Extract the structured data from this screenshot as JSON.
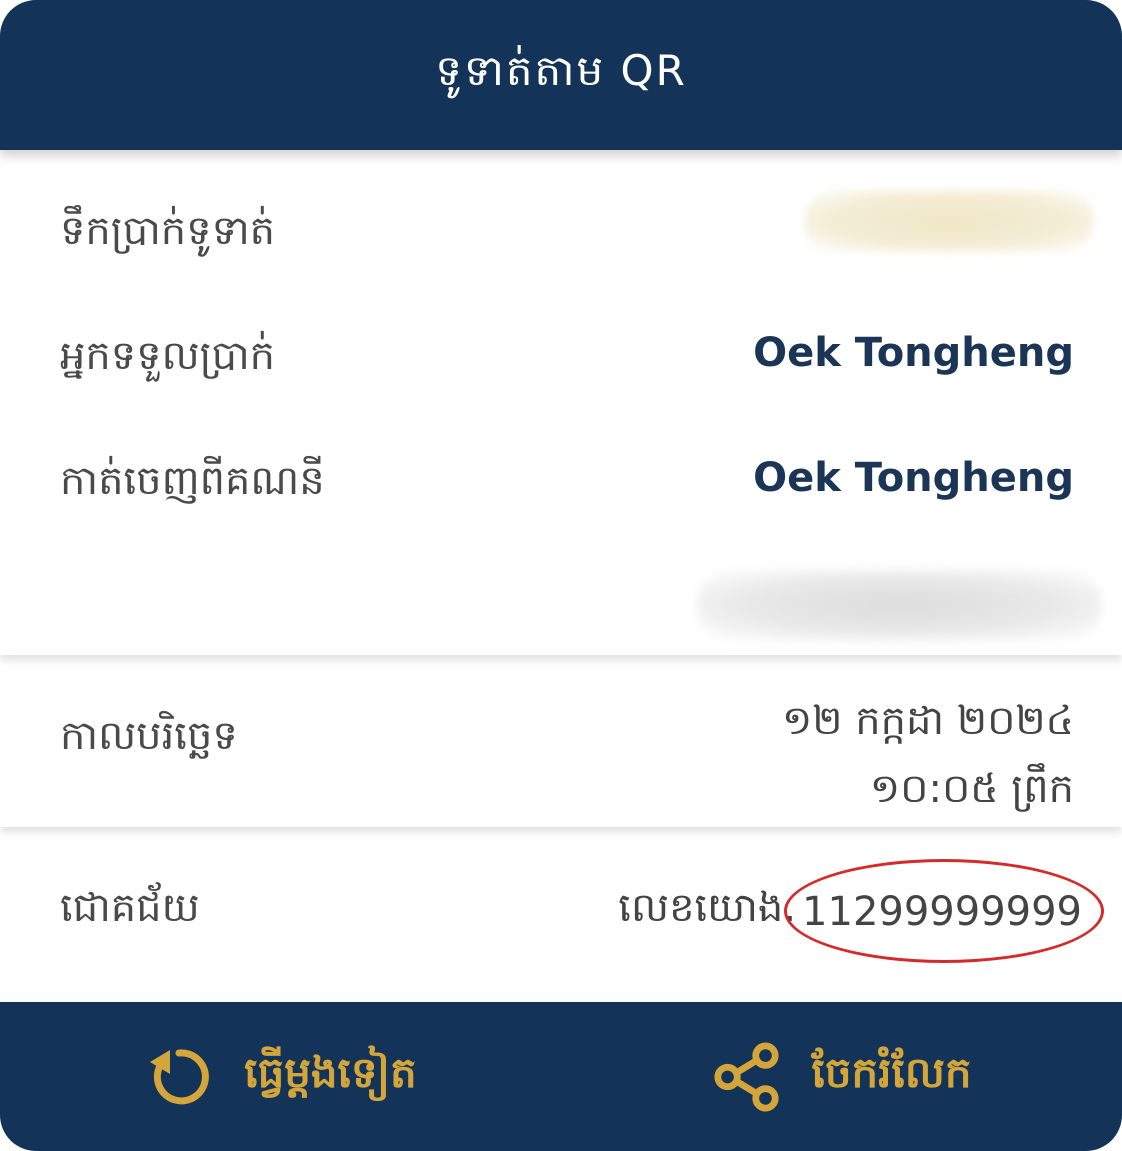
{
  "header": {
    "title": "ទូទាត់តាម QR"
  },
  "details": {
    "amount_label": "ទឹកប្រាក់ទូទាត់",
    "receiver_label": "អ្នកទទួលប្រាក់",
    "receiver_value": "Oek Tongheng",
    "from_account_label": "កាត់ចេញពីគណនី",
    "from_account_value": "Oek Tongheng"
  },
  "datetime": {
    "label": "កាលបរិច្ឆេទ",
    "date": "១២ កក្កដា ២០២៤",
    "time": "១០:០៥ ព្រឹក"
  },
  "status": {
    "label": "ជោគជ័យ",
    "reference_prefix": "លេខយោង.",
    "reference_number": "11299999999"
  },
  "footer": {
    "retry_label": "ធ្វើម្តងទៀត",
    "share_label": "ចែករំលែក",
    "retry_icon": "refresh-icon",
    "share_icon": "share-icon"
  },
  "colors": {
    "primary": "#133359",
    "accent": "#d4a63a",
    "highlight": "#d42a2a"
  }
}
